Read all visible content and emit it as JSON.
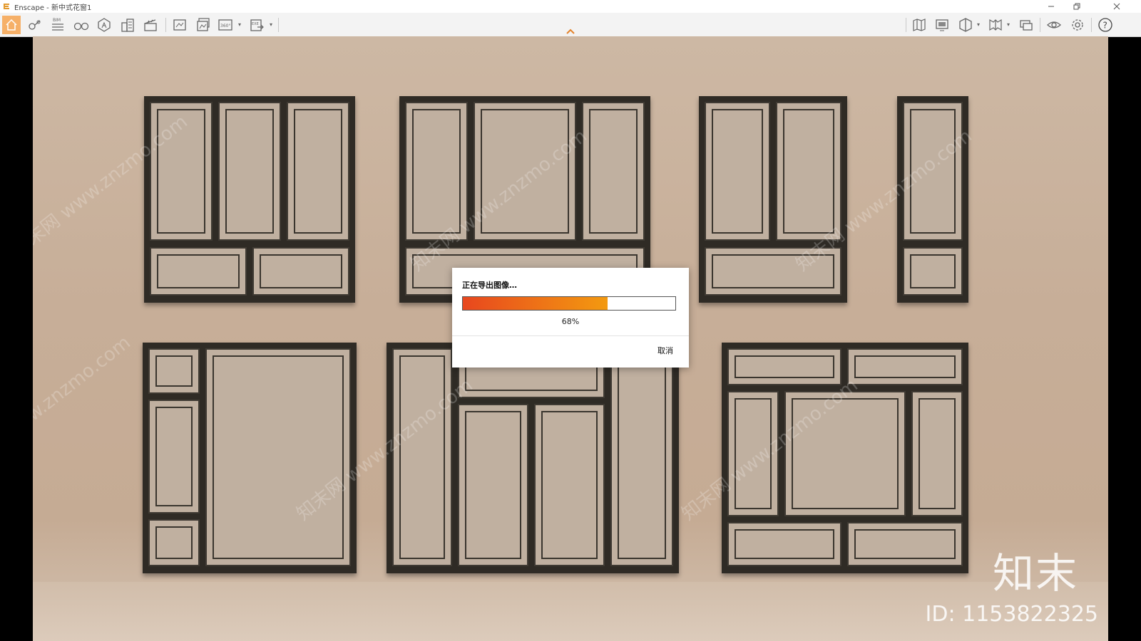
{
  "window": {
    "app_name": "Enscape",
    "title": "Enscape - 新中式花窗1",
    "minimize_icon": "minimize-icon",
    "restore_icon": "restore-icon",
    "close_icon": "close-icon"
  },
  "toolbar": {
    "bim_label": "BIM",
    "btn_360_label": "360°",
    "btn_exe_label": "EXE",
    "left_icons": [
      "home-icon",
      "camera-position-icon",
      "bim-info-icon",
      "binoculars-icon",
      "asset-library-icon",
      "buildings-icon",
      "clapperboard-icon",
      "screenshot-icon",
      "batch-render-icon",
      "panorama-360-icon",
      "export-exe-icon"
    ],
    "right_icons": [
      "map-icon",
      "monitor-icon",
      "vr-headset-icon",
      "book-icon",
      "chat-icon",
      "eye-icon",
      "gear-icon",
      "help-icon"
    ],
    "active": "home-icon",
    "accent_color": "#f6b068"
  },
  "viewport": {
    "watermark_text": "知末网 www.znzmo.com",
    "brand": "知末",
    "id_label": "ID: 1153822325"
  },
  "dialog": {
    "title": "正在导出图像…",
    "progress_percent": 68,
    "progress_text": "68%",
    "cancel_label": "取消",
    "progress_colors": [
      "#e8471e",
      "#f39a10"
    ]
  }
}
